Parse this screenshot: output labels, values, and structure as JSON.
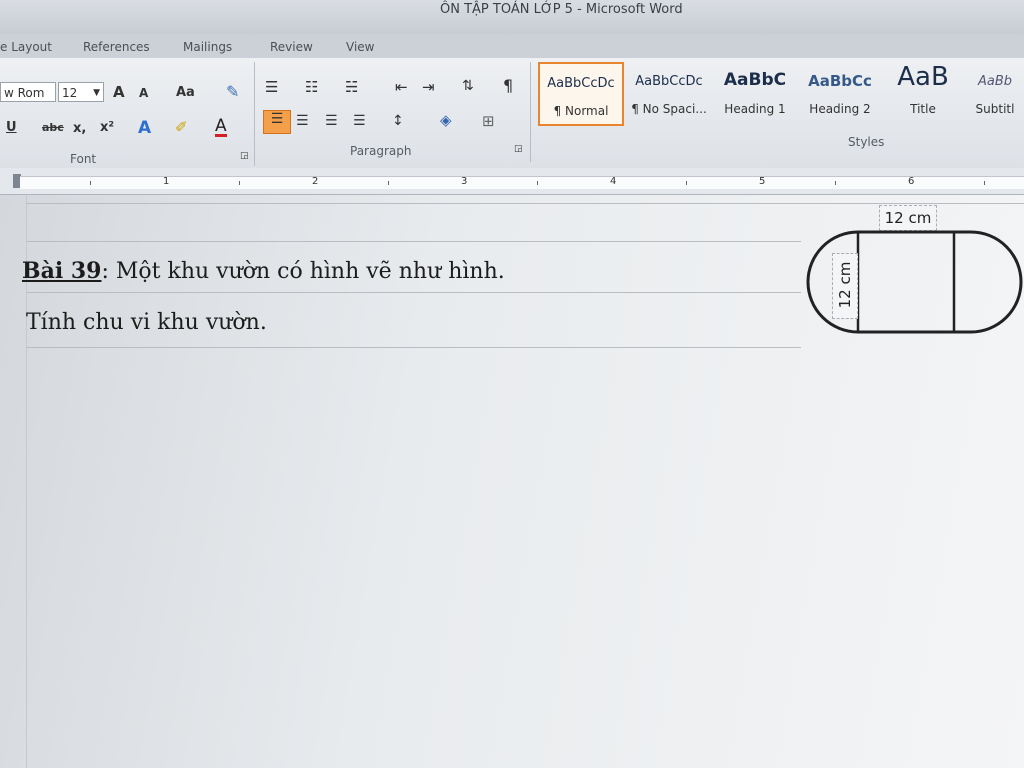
{
  "window": {
    "title": "ÔN TẬP TOÁN LỚP 5 - Microsoft Word"
  },
  "tabs": [
    "e Layout",
    "References",
    "Mailings",
    "Review",
    "View"
  ],
  "font": {
    "name": "w Rom",
    "size": "12",
    "grow_label": "A",
    "shrink_label": "A",
    "case_label": "Aa",
    "underline_label": "U",
    "strike_label": "abc",
    "subscript_label": "x,",
    "superscript_label": "x²",
    "color_label": "A"
  },
  "groups": {
    "font": "Font",
    "paragraph": "Paragraph",
    "styles": "Styles"
  },
  "styles": [
    {
      "sample": "AaBbCcDc",
      "name": "¶ Normal"
    },
    {
      "sample": "AaBbCcDc",
      "name": "¶ No Spaci..."
    },
    {
      "sample": "AaBbC",
      "name": "Heading 1"
    },
    {
      "sample": "AaBbCc",
      "name": "Heading 2"
    },
    {
      "sample": "AaB",
      "name": "Title"
    },
    {
      "sample": "AaBb",
      "name": "Subtitl"
    }
  ],
  "ruler": {
    "numbers": [
      "1",
      "2",
      "3",
      "4",
      "5",
      "6"
    ]
  },
  "document": {
    "exercise_label": "Bài 39",
    "line1_rest": ": Một khu vườn có hình vẽ như hình.",
    "line2": "Tính chu vi khu vườn."
  },
  "figure": {
    "top_label": "12 cm",
    "side_label": "12 cm"
  },
  "colors": {
    "accent_orange": "#e8852e",
    "text_blue": "#1c2e4a"
  }
}
